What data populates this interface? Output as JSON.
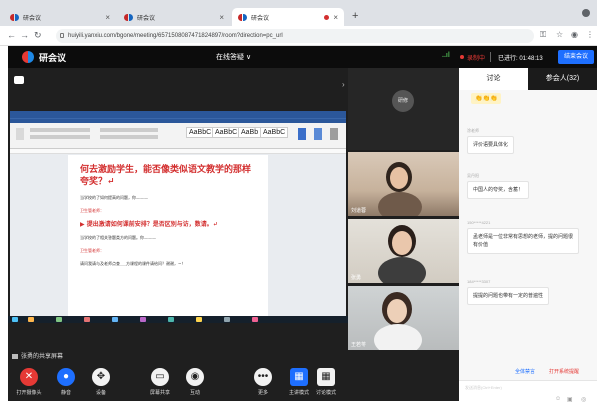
{
  "browser": {
    "tabs": [
      {
        "title": "研会议",
        "close": "×",
        "active": false
      },
      {
        "title": "研会议",
        "close": "×",
        "active": false
      },
      {
        "title": "研会议",
        "close": "×",
        "active": true
      }
    ],
    "new_tab": "+",
    "url": "huiyili.yanxiu.com/bgone/meeting/6571508087471824897/room?direction=pc_url",
    "icons": [
      "back-icon",
      "forward-icon",
      "reload-icon",
      "lock-icon",
      "key-icon",
      "star-icon",
      "profile-icon",
      "menu-icon"
    ]
  },
  "meeting": {
    "brand": "研会议",
    "title": "在线答疑 ∨",
    "signal": "..ıl",
    "recording": "录制中",
    "elapsed": "已进行: 01:48:13",
    "end_button": "结束会议",
    "expand_arrow": "›",
    "share_label": "张勇的共享屏幕",
    "controls": [
      {
        "label": "打开摄像头",
        "glyph": "✕",
        "style": "red"
      },
      {
        "label": "静音",
        "glyph": "●",
        "style": "blue"
      },
      {
        "label": "设备",
        "glyph": "✥",
        "style": ""
      },
      {
        "label": "屏幕共享",
        "glyph": "▭",
        "style": ""
      },
      {
        "label": "互动",
        "glyph": "◉",
        "style": ""
      },
      {
        "label": "更多",
        "glyph": "•••",
        "style": ""
      },
      {
        "label": "主讲模式",
        "glyph": "▦",
        "style": "blue sq"
      },
      {
        "label": "讨论模式",
        "glyph": "▦",
        "style": "sq"
      }
    ]
  },
  "document": {
    "styles": [
      "AaBbC",
      "AaBbC",
      "AaBb",
      "AaBbC"
    ],
    "heading": "何去激励学生，能否像类似语文教学的那样夸奖？↵",
    "lines": [
      "当学校的了如何提高的问题，你———",
      "卫生管老师：",
      "▶ 提出激请如何课前安排？是否区别与访，数请。↵",
      "当学校的了相关答题类方的问题。你———",
      "卫生管老师：",
      "请问我请与及老师点查___方课程的课件请给问？谢谢，~！"
    ]
  },
  "participants": [
    {
      "name": "研修",
      "type": "avatar-tile"
    },
    {
      "name": "刘道蓉",
      "type": "video"
    },
    {
      "name": "张勇",
      "type": "video"
    },
    {
      "name": "王若苓",
      "type": "video"
    }
  ],
  "sidebar": {
    "tabs": [
      "讨论",
      "参会人(32)"
    ],
    "emoji_message": "👏👏👏",
    "messages": [
      {
        "time": "",
        "sender": "涂老师",
        "text": "评价语要具体化"
      },
      {
        "time": "",
        "sender": "吴丹阳",
        "text": "中国人的夸奖，含蓄！"
      },
      {
        "time": "",
        "sender": "150*****4221",
        "text": "孟老师是一位非常有思想的老师，提的问题很有价值"
      },
      {
        "time": "",
        "sender": "184*****3307",
        "text": "提提的问题也带有一定的普遍性"
      }
    ],
    "links": [
      "全体禁言",
      "打开系统提醒"
    ],
    "input_placeholder": "发送消息(Ctrl+Enter)",
    "footer_icons": [
      "emoji-icon",
      "image-icon",
      "send-icon"
    ]
  }
}
